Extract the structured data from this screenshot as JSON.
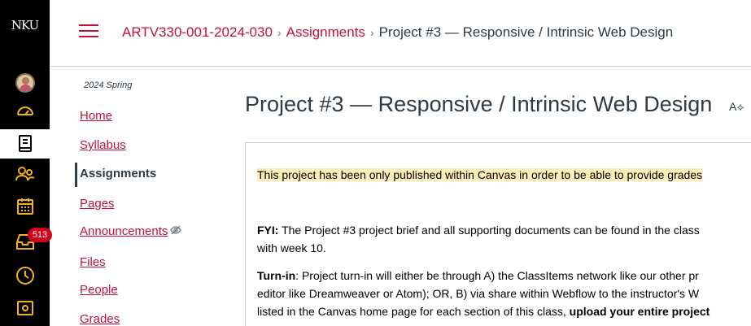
{
  "global_nav": {
    "logo": "NKU",
    "notification_count": "513"
  },
  "header": {
    "crumb_course": "ARTV330-001-2024-030",
    "crumb_section": "Assignments",
    "crumb_current": "Project #3 — Responsive / Intrinsic Web Design"
  },
  "course_nav": {
    "term": "2024 Spring",
    "items": [
      "Home",
      "Syllabus",
      "Assignments",
      "Pages",
      "Announcements",
      "Files",
      "People",
      "Grades"
    ]
  },
  "content": {
    "title": "Project #3 — Responsive / Intrinsic Web Design",
    "notice": "This project has been only published within Canvas in order to be able to provide grades",
    "fyi_label": "FYI:",
    "fyi_text": " The Project #3 project brief and all supporting documents can be found in the class",
    "fyi_text2": "with week 10.",
    "turnin_label": "Turn-in",
    "turnin_text": ": Project turn-in will either be through A) the ClassItems network like our other pr",
    "turnin_text2": "editor like Dreamweaver or Atom); OR, B) via share within Webflow to the instructor's W",
    "turnin_text3": "listed in the Canvas home page for each section of this class, ",
    "turnin_bold": "upload your entire project"
  }
}
